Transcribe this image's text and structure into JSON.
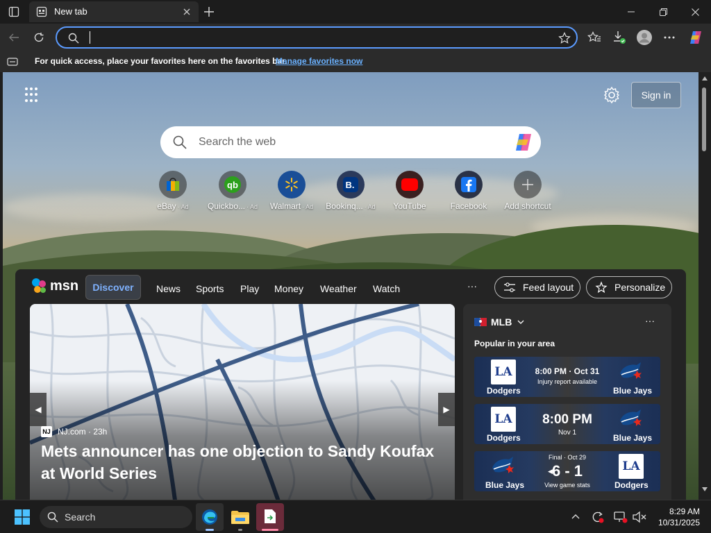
{
  "tab": {
    "title": "New tab"
  },
  "favorites_bar": {
    "hint": "For quick access, place your favorites here on the favorites bar.",
    "manage_link": "Manage favorites now"
  },
  "header": {
    "signin": "Sign in"
  },
  "search": {
    "placeholder": "Search the web"
  },
  "shortcuts": [
    {
      "label": "eBay",
      "ad": "· Ad",
      "icon": "ebay-icon"
    },
    {
      "label": "Quickbo...",
      "ad": "· Ad",
      "icon": "quickbooks-icon"
    },
    {
      "label": "Walmart",
      "ad": "· Ad",
      "icon": "walmart-icon"
    },
    {
      "label": "Bookinq...",
      "ad": "· Ad",
      "icon": "booking-icon"
    },
    {
      "label": "YouTube",
      "ad": "",
      "icon": "youtube-icon"
    },
    {
      "label": "Facebook",
      "ad": "",
      "icon": "facebook-icon"
    },
    {
      "label": "Add shortcut",
      "ad": "",
      "icon": "plus-icon"
    }
  ],
  "feed": {
    "logo": "msn",
    "tabs": [
      "Discover",
      "News",
      "Sports",
      "Play",
      "Money",
      "Weather",
      "Watch"
    ],
    "more": "···",
    "feed_layout": "Feed layout",
    "personalize": "Personalize"
  },
  "hero": {
    "source": "NJ.com · 23h",
    "source_icon": "NJ",
    "headline": "Mets announcer has one objection to Sandy Koufax at World Series"
  },
  "mlb": {
    "title": "MLB",
    "more": "···",
    "popular": "Popular in your area",
    "games": [
      {
        "left_team": "Dodgers",
        "right_team": "Blue Jays",
        "line1": "8:00 PM · Oct 31",
        "line2": "Injury report available"
      },
      {
        "left_team": "Dodgers",
        "right_team": "Blue Jays",
        "line1": "8:00 PM",
        "line2": "Nov 1"
      },
      {
        "left_team": "Blue Jays",
        "right_team": "Dodgers",
        "line0": "Final · Oct 29",
        "line1": "6 - 1",
        "line2": "View game stats"
      }
    ]
  },
  "taskbar": {
    "search": "Search",
    "time": "8:29 AM",
    "date": "10/31/2025"
  },
  "colors": {
    "accent": "#5b9bff",
    "link": "#6ab1ff",
    "discover": "#7fb2ff"
  }
}
